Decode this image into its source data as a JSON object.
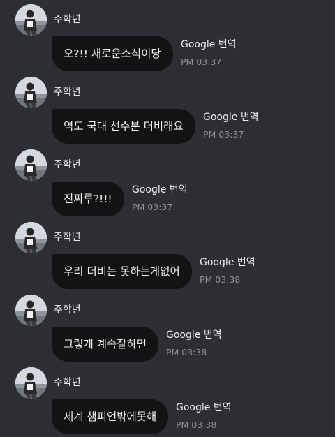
{
  "messages": [
    {
      "sender": "주학년",
      "text": "오?!! 새로운소식이당",
      "translate": "Google 번역",
      "time": "PM 03:37"
    },
    {
      "sender": "주학년",
      "text": "역도 국대 선수분 더비래요",
      "translate": "Google 번역",
      "time": "PM 03:37"
    },
    {
      "sender": "주학년",
      "text": "진짜루?!!!",
      "translate": "Google 번역",
      "time": "PM 03:37"
    },
    {
      "sender": "주학년",
      "text": "우리 더비는 못하는게없어",
      "translate": "Google 번역",
      "time": "PM 03:38"
    },
    {
      "sender": "주학년",
      "text": "그렇게 계속잘하면",
      "translate": "Google 번역",
      "time": "PM 03:38"
    },
    {
      "sender": "주학년",
      "text": "세계 챔피언밖에못해",
      "translate": "Google 번역",
      "time": "PM 03:38"
    }
  ],
  "colors": {
    "background": "#2d2e33",
    "bubble": "#131313",
    "bubble_text": "#f2f2f2",
    "time_text": "#8e9097"
  }
}
